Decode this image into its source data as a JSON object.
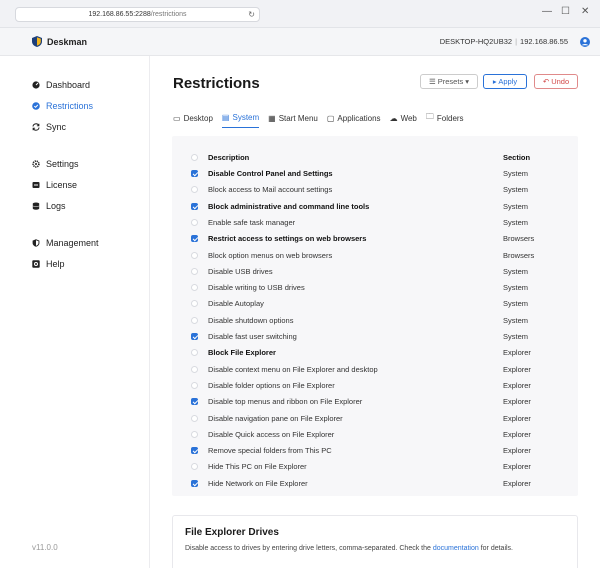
{
  "browser": {
    "url_host": "192.168.86.55:2288",
    "url_path": "/restrictions",
    "controls": [
      "—",
      "☐",
      "✕"
    ]
  },
  "app": {
    "brand": "Deskman",
    "hostname": "DESKTOP-HQ2UB32",
    "ip": "192.168.86.55"
  },
  "sidebar": {
    "items": [
      {
        "label": "Dashboard",
        "icon": "gauge-icon"
      },
      {
        "label": "Restrictions",
        "icon": "shield-check-icon",
        "active": true
      },
      {
        "label": "Sync",
        "icon": "sync-icon"
      },
      {
        "label": "Settings",
        "icon": "gear-icon"
      },
      {
        "label": "License",
        "icon": "license-icon"
      },
      {
        "label": "Logs",
        "icon": "logs-icon"
      },
      {
        "label": "Management",
        "icon": "shield-half-icon"
      },
      {
        "label": "Help",
        "icon": "help-icon"
      }
    ],
    "version": "v11.0.0"
  },
  "page": {
    "title": "Restrictions",
    "presets_label": "Presets",
    "apply_label": "Apply",
    "undo_label": "Undo"
  },
  "tabs": [
    {
      "label": "Desktop",
      "icon": "monitor-icon"
    },
    {
      "label": "System",
      "icon": "system-icon",
      "active": true
    },
    {
      "label": "Start Menu",
      "icon": "start-menu-icon"
    },
    {
      "label": "Applications",
      "icon": "window-icon"
    },
    {
      "label": "Web",
      "icon": "cloud-icon"
    },
    {
      "label": "Folders",
      "icon": "folder-icon"
    }
  ],
  "table": {
    "headers": {
      "description": "Description",
      "section": "Section"
    },
    "rows": [
      {
        "description": "Disable Control Panel and Settings",
        "section": "System",
        "checked": true,
        "bold": true
      },
      {
        "description": "Block access to Mail account settings",
        "section": "System",
        "checked": false,
        "bold": false
      },
      {
        "description": "Block administrative and command line tools",
        "section": "System",
        "checked": true,
        "bold": true
      },
      {
        "description": "Enable safe task manager",
        "section": "System",
        "checked": false,
        "bold": false
      },
      {
        "description": "Restrict access to settings on web browsers",
        "section": "Browsers",
        "checked": true,
        "bold": true
      },
      {
        "description": "Block option menus on web browsers",
        "section": "Browsers",
        "checked": false,
        "bold": false
      },
      {
        "description": "Disable USB drives",
        "section": "System",
        "checked": false,
        "bold": false
      },
      {
        "description": "Disable writing to USB drives",
        "section": "System",
        "checked": false,
        "bold": false
      },
      {
        "description": "Disable Autoplay",
        "section": "System",
        "checked": false,
        "bold": false
      },
      {
        "description": "Disable shutdown options",
        "section": "System",
        "checked": false,
        "bold": false
      },
      {
        "description": "Disable fast user switching",
        "section": "System",
        "checked": true,
        "bold": false
      },
      {
        "description": "Block File Explorer",
        "section": "Explorer",
        "checked": false,
        "bold": true
      },
      {
        "description": "Disable context menu on File Explorer and desktop",
        "section": "Explorer",
        "checked": false,
        "bold": false
      },
      {
        "description": "Disable folder options on File Explorer",
        "section": "Explorer",
        "checked": false,
        "bold": false
      },
      {
        "description": "Disable top menus and ribbon on File Explorer",
        "section": "Explorer",
        "checked": true,
        "bold": false
      },
      {
        "description": "Disable navigation pane on File Explorer",
        "section": "Explorer",
        "checked": false,
        "bold": false
      },
      {
        "description": "Disable Quick access on File Explorer",
        "section": "Explorer",
        "checked": false,
        "bold": false
      },
      {
        "description": "Remove special folders from This PC",
        "section": "Explorer",
        "checked": true,
        "bold": false
      },
      {
        "description": "Hide This PC on File Explorer",
        "section": "Explorer",
        "checked": false,
        "bold": false
      },
      {
        "description": "Hide Network on File Explorer",
        "section": "Explorer",
        "checked": true,
        "bold": false
      }
    ]
  },
  "drives": {
    "title": "File Explorer Drives",
    "desc_before": "Disable access to drives by entering drive letters, comma-separated. Check the ",
    "desc_link": "documentation",
    "desc_after": " for details."
  },
  "colors": {
    "accent": "#2a72d8",
    "danger": "#d24a4a"
  }
}
